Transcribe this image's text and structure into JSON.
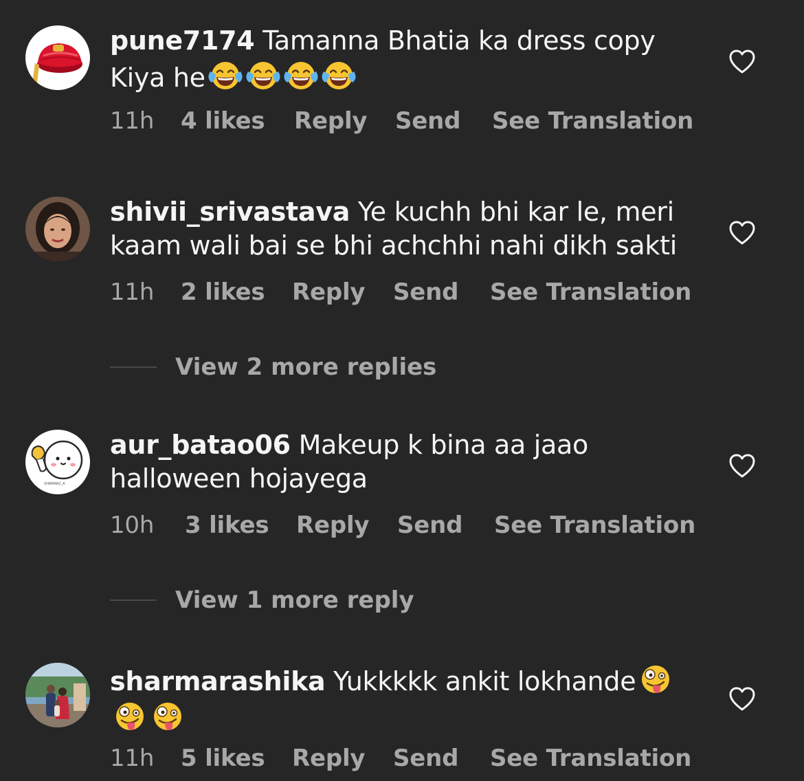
{
  "comments": [
    {
      "username": "pune7174",
      "text": "Tamanna Bhatia ka dress copy Kiya he",
      "emoji_text": "😂😂😂😂",
      "time": "11h",
      "likes": "4 likes",
      "reply": "Reply",
      "send": "Send",
      "translate": "See Translation"
    },
    {
      "username": "shivii_srivastava",
      "text": "Ye kuchh bhi kar le, meri kaam wali bai se bhi achchhi nahi dikh sakti",
      "time": "11h",
      "likes": "2 likes",
      "reply": "Reply",
      "send": "Send",
      "translate": "See Translation",
      "view_more": "View 2 more replies"
    },
    {
      "username": "aur_batao06",
      "text": "Makeup k bina aa jaao halloween hojayega",
      "avatar_caption": "SHARMAZ_A",
      "time": "10h",
      "likes": "3 likes",
      "reply": "Reply",
      "send": "Send",
      "translate": "See Translation",
      "view_more": "View 1 more reply"
    },
    {
      "username": "sharmarashika",
      "text": "Yukkkkk ankit lokhande",
      "emoji_text": "🤪🤪🤪",
      "time": "11h",
      "likes": "5 likes",
      "reply": "Reply",
      "send": "Send",
      "translate": "See Translation"
    }
  ],
  "icons": {
    "like": "heart-outline-icon",
    "tears_of_joy": "face-with-tears-of-joy-emoji",
    "zany": "zany-face-emoji"
  },
  "colors": {
    "background": "#262626",
    "primary_text": "#f5f5f5",
    "secondary_text": "#a8a8a8"
  }
}
